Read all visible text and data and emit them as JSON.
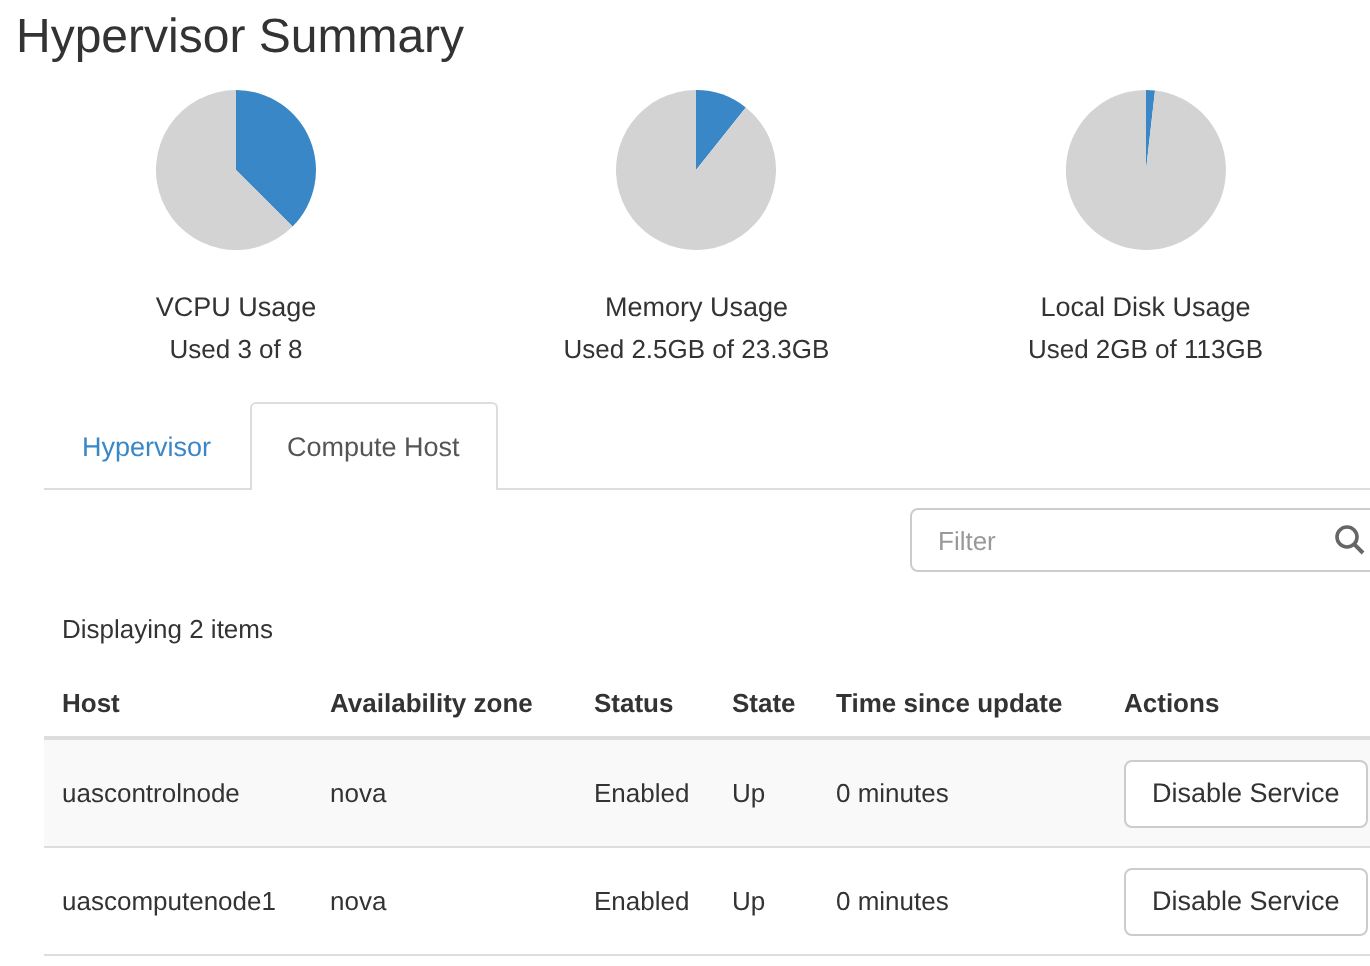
{
  "title": "Hypervisor Summary",
  "usage": [
    {
      "name": "VCPU Usage",
      "detail": "Used 3 of 8",
      "chart_data": {
        "type": "pie",
        "values": [
          37.5,
          62.5
        ]
      }
    },
    {
      "name": "Memory Usage",
      "detail": "Used 2.5GB of 23.3GB",
      "chart_data": {
        "type": "pie",
        "values": [
          10.7,
          89.3
        ]
      }
    },
    {
      "name": "Local Disk Usage",
      "detail": "Used 2GB of 113GB",
      "chart_data": {
        "type": "pie",
        "values": [
          1.8,
          98.2
        ]
      }
    }
  ],
  "tabs": [
    {
      "label": "Hypervisor",
      "selected": false
    },
    {
      "label": "Compute Host",
      "selected": true
    }
  ],
  "filter": {
    "placeholder": "Filter"
  },
  "count": "Displaying 2 items",
  "table": {
    "columns": [
      "Host",
      "Availability zone",
      "Status",
      "State",
      "Time since update",
      "Actions"
    ],
    "rows": [
      {
        "cells": [
          "uascontrolnode",
          "nova",
          "Enabled",
          "Up",
          "0 minutes"
        ],
        "action": "Disable Service"
      },
      {
        "cells": [
          "uascomputenode1",
          "nova",
          "Enabled",
          "Up",
          "0 minutes"
        ],
        "action": "Disable Service"
      }
    ]
  }
}
